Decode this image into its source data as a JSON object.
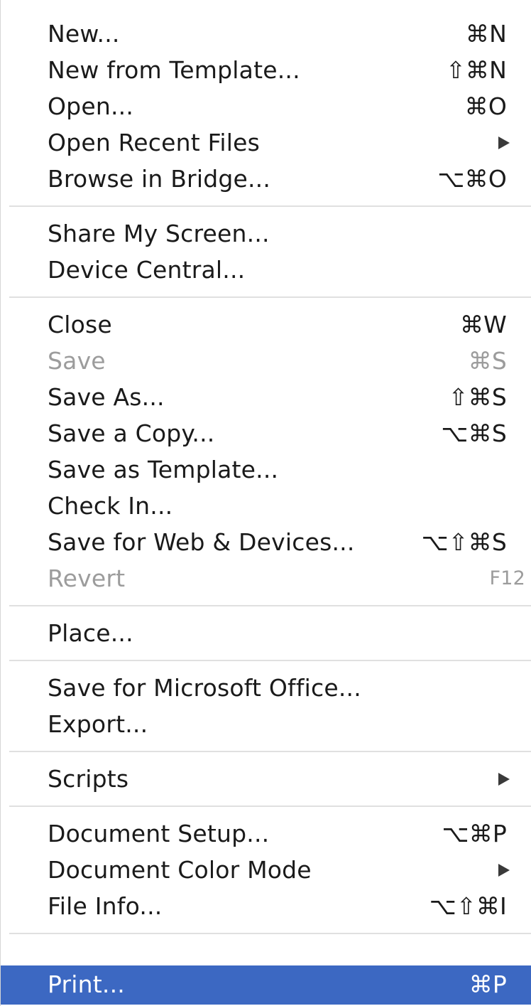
{
  "menu": {
    "groups": [
      [
        {
          "label": "New...",
          "shortcut": "⌘N"
        },
        {
          "label": "New from Template...",
          "shortcut": "⇧⌘N"
        },
        {
          "label": "Open...",
          "shortcut": "⌘O"
        },
        {
          "label": "Open Recent Files",
          "submenu": true
        },
        {
          "label": "Browse in Bridge...",
          "shortcut": "⌥⌘O"
        }
      ],
      [
        {
          "label": "Share My Screen..."
        },
        {
          "label": "Device Central..."
        }
      ],
      [
        {
          "label": "Close",
          "shortcut": "⌘W"
        },
        {
          "label": "Save",
          "shortcut": "⌘S",
          "disabled": true
        },
        {
          "label": "Save As...",
          "shortcut": "⇧⌘S"
        },
        {
          "label": "Save a Copy...",
          "shortcut": "⌥⌘S"
        },
        {
          "label": "Save as Template..."
        },
        {
          "label": "Check In..."
        },
        {
          "label": "Save for Web & Devices...",
          "shortcut": "⌥⇧⌘S"
        },
        {
          "label": "Revert",
          "shortcut": "F12",
          "disabled": true
        }
      ],
      [
        {
          "label": "Place..."
        }
      ],
      [
        {
          "label": "Save for Microsoft Office..."
        },
        {
          "label": "Export..."
        }
      ],
      [
        {
          "label": "Scripts",
          "submenu": true
        }
      ],
      [
        {
          "label": "Document Setup...",
          "shortcut": "⌥⌘P"
        },
        {
          "label": "Document Color Mode",
          "submenu": true
        },
        {
          "label": "File Info...",
          "shortcut": "⌥⇧⌘I"
        }
      ],
      [
        {
          "label": "Print...",
          "shortcut": "⌘P",
          "selected": true
        }
      ]
    ],
    "colors": {
      "highlight": "#3c68c2",
      "disabled_text": "#9c9c9c",
      "separator": "#e0e0e0"
    }
  }
}
